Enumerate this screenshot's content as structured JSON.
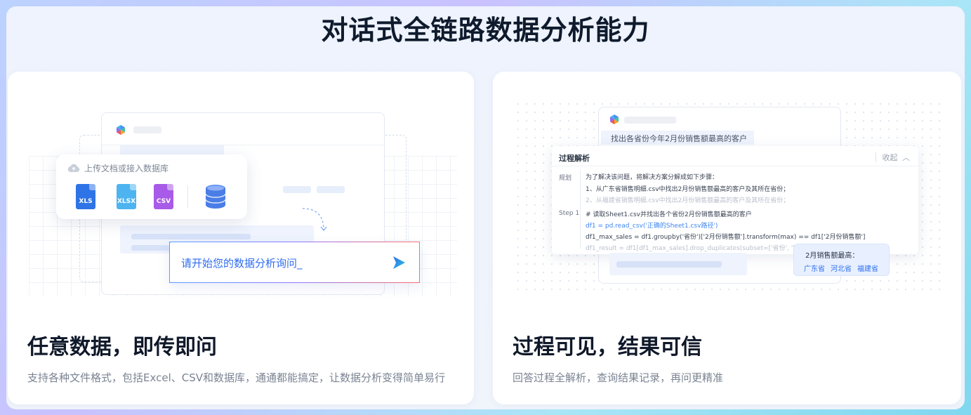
{
  "page": {
    "title": "对话式全链路数据分析能力"
  },
  "cards": [
    {
      "title": "任意数据，即传即问",
      "description": "支持各种文件格式，包括Excel、CSV和数据库，通通都能搞定，让数据分析变得简单易行",
      "upload_label": "上传文档或接入数据库",
      "file_types": [
        {
          "label": "XLS",
          "color": "#2f74e6",
          "icon": "xls-file-icon"
        },
        {
          "label": "XLSX",
          "color": "#4db4f0",
          "icon": "xlsx-file-icon"
        },
        {
          "label": "CSV",
          "color": "#a75be8",
          "icon": "csv-file-icon"
        }
      ],
      "database_icon": "database-icon",
      "query_placeholder": "请开始您的数据分析询问_",
      "send_icon": "send-icon"
    },
    {
      "title": "过程可见，结果可信",
      "description": "回答过程全解析，查询结果记录，再问更精准",
      "question": "找出各省份今年2月份销售额最高的客户",
      "process_title": "过程解析",
      "collapse_label": "收起",
      "plan_label": "规划",
      "plan_lines": [
        "为了解决该问题，将解决方案分解成如下步骤：",
        "1、从广东省销售明细.csv中找出2月份销售额最高的客户及其所在省份；",
        "2、从福建省销售明细.csv中找出2月份销售额最高的客户及其所在省份；"
      ],
      "step_label": "Step 1",
      "code_lines": [
        "# 读取Sheet1.csv并找出各个省份2月份销售额最高的客户",
        "df1 = pd.read_csv('正确的Sheet1.csv路径')",
        "df1_max_sales = df1.groupby('省份')['2月份销售额'].transform(max) == df1['2月份销售额']",
        "df1_result = df1[df1_max_sales].drop_duplicates(subset=['省份', '客户名称'])"
      ],
      "result_title": "2月销售额最高：",
      "result_values": [
        "广东省",
        "河北省",
        "福建省"
      ]
    }
  ]
}
